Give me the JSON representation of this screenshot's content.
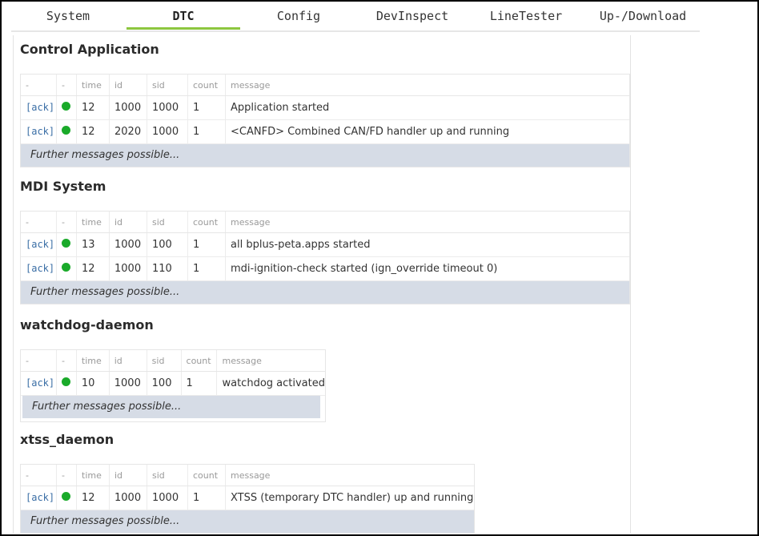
{
  "tabs": [
    {
      "label": "System",
      "active": false
    },
    {
      "label": "DTC",
      "active": true
    },
    {
      "label": "Config",
      "active": false
    },
    {
      "label": "DevInspect",
      "active": false
    },
    {
      "label": "LineTester",
      "active": false
    },
    {
      "label": "Up-/Download",
      "active": false
    }
  ],
  "columns": {
    "c0": "-",
    "c1": "-",
    "time": "time",
    "id": "id",
    "sid": "sid",
    "count": "count",
    "message": "message"
  },
  "ack_label": "[ack]",
  "status_color": "#1aaa2a",
  "further_text": "Further messages possible...",
  "sections": [
    {
      "title": "Control Application",
      "rows": [
        {
          "time": "12",
          "id": "1000",
          "sid": "1000",
          "count": "1",
          "message": "Application started"
        },
        {
          "time": "12",
          "id": "2020",
          "sid": "1000",
          "count": "1",
          "message": "<CANFD> Combined CAN/FD handler up and running"
        }
      ]
    },
    {
      "title": "MDI System",
      "rows": [
        {
          "time": "13",
          "id": "1000",
          "sid": "100",
          "count": "1",
          "message": "all bplus-peta.apps started"
        },
        {
          "time": "12",
          "id": "1000",
          "sid": "110",
          "count": "1",
          "message": "mdi-ignition-check started (ign_override timeout 0)"
        }
      ]
    },
    {
      "title": "watchdog-daemon",
      "rows": [
        {
          "time": "10",
          "id": "1000",
          "sid": "100",
          "count": "1",
          "message": "watchdog activated"
        }
      ]
    },
    {
      "title": "xtss_daemon",
      "rows": [
        {
          "time": "12",
          "id": "1000",
          "sid": "1000",
          "count": "1",
          "message": "XTSS (temporary DTC handler) up and running"
        }
      ]
    }
  ]
}
